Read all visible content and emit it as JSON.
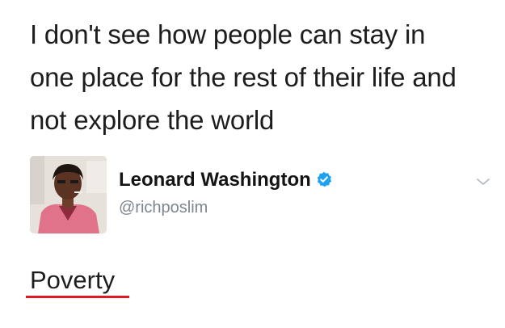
{
  "quoted_tweet": {
    "lines": [
      "I don't see how people can stay in",
      "one place for the rest of their life and",
      "not explore the world"
    ]
  },
  "reply": {
    "author": {
      "display_name": "Leonard Washington",
      "handle": "@richposlim",
      "verified": true,
      "avatar_icon": "profile-photo"
    },
    "menu_icon": "chevron-down-icon",
    "text": "Poverty",
    "annotation_color": "#e3191f"
  },
  "colors": {
    "text": "#1d1d1d",
    "handle": "#7b8690",
    "verified_badge": "#1da1f2"
  }
}
